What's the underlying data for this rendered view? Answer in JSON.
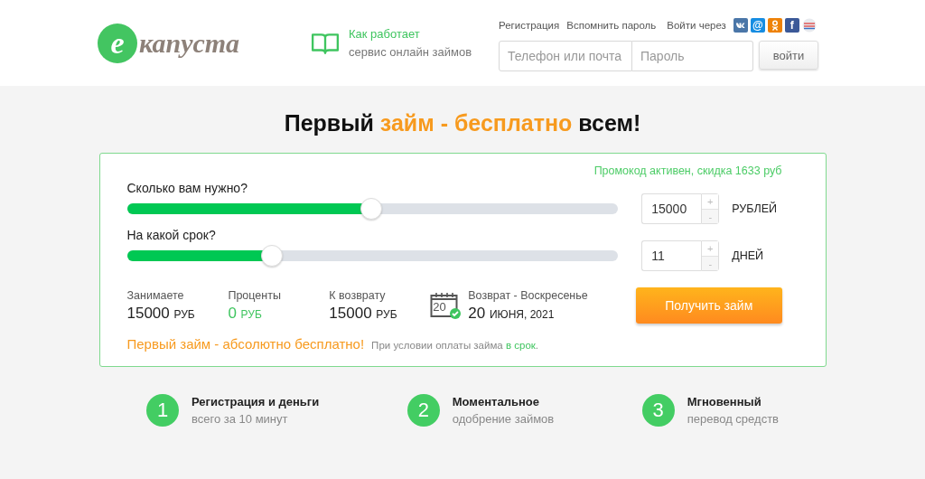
{
  "header": {
    "logo": {
      "letter": "е",
      "name": "капуста"
    },
    "how_it_works": {
      "title": "Как работает",
      "subtitle": "сервис онлайн займов"
    },
    "links": [
      "Регистрация",
      "Вспомнить пароль"
    ],
    "social_label": "Войти через",
    "socials": [
      {
        "kind": "vk",
        "color": "#4a76a8"
      },
      {
        "kind": "glyph",
        "glyph": "@",
        "color": "#168de2"
      },
      {
        "kind": "ok",
        "color": "#ee8208"
      },
      {
        "kind": "glyph",
        "glyph": "f",
        "color": "#3b5998"
      },
      {
        "kind": "gos",
        "color": "#e8eaee"
      }
    ],
    "login": {
      "placeholder": "Телефон или почта"
    },
    "password": {
      "placeholder": "Пароль"
    },
    "login_button": "войти"
  },
  "headline": {
    "before": "Первый ",
    "highlight": "займ - бесплатно",
    "after": " всем!"
  },
  "calculator": {
    "promo": "Промокод активен, скидка 1633 руб",
    "sliders": [
      {
        "label": "Сколько вам нужно?",
        "level": 0.497,
        "value": "15000",
        "unit": "РУБЛЕЙ",
        "plus": "+",
        "minus": "-"
      },
      {
        "label": "На какой срок?",
        "level": 0.295,
        "value": "11",
        "unit": "ДНЕЙ",
        "plus": "+",
        "minus": "-"
      }
    ],
    "summary": [
      {
        "label": "Занимаете",
        "amount": "15000",
        "unit": "РУБ",
        "highlight": false
      },
      {
        "label": "Проценты",
        "amount": "0",
        "unit": "РУБ",
        "highlight": true
      },
      {
        "label": "К возврату",
        "amount": "15000",
        "unit": "РУБ",
        "highlight": false
      }
    ],
    "return": {
      "calendar_day": "20",
      "label": "Возврат - Воскресенье",
      "day": "20",
      "date": "ИЮНЯ, 2021"
    },
    "submit": "Получить займ",
    "note": {
      "highlight": "Первый займ - абсолютно бесплатно!",
      "text": "При условии оплаты займа",
      "link": "в срок",
      "end": "."
    }
  },
  "steps": [
    {
      "number": "1",
      "title": "Регистрация и деньги",
      "subtitle": "всего за 10 минут"
    },
    {
      "number": "2",
      "title": "Моментальное",
      "subtitle": "одобрение займов"
    },
    {
      "number": "3",
      "title": "Мгновенный",
      "subtitle": "перевод средств"
    }
  ]
}
